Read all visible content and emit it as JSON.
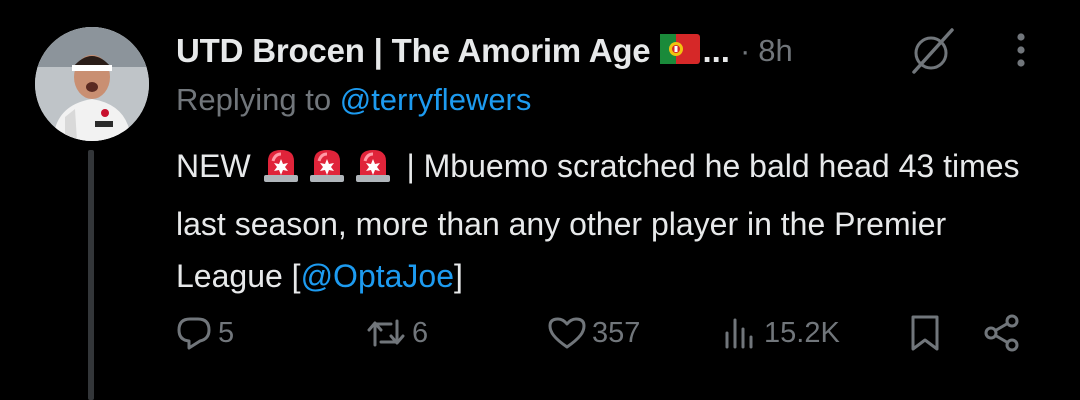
{
  "user": {
    "display_name": "UTD Brocen | The Amorim Age",
    "truncation": "...",
    "separator": "·",
    "time": "8h",
    "avatar_icon": "footballer-avatar"
  },
  "reply": {
    "prefix": "Replying to",
    "handle": "@terryflewers"
  },
  "body": {
    "lead": "NEW",
    "text": " | Mbuemo scratched he bald head 43 times last season, more than any other player in the Premier League [",
    "mention": "@OptaJoe",
    "close": "]"
  },
  "actions": {
    "replies": "5",
    "reposts": "6",
    "likes": "357",
    "views": "15.2K"
  },
  "colors": {
    "background": "#000000",
    "text": "#e7e9ea",
    "muted": "#71767b",
    "accent": "#1d9bf0"
  }
}
